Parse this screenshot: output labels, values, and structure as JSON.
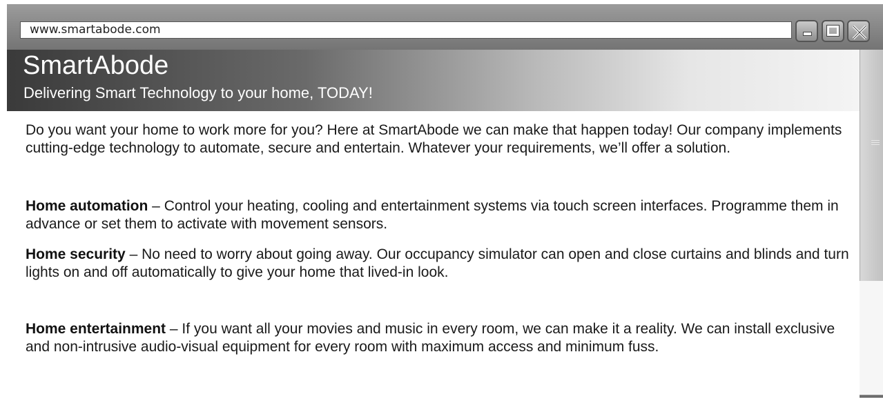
{
  "browser": {
    "url": "www.smartabode.com"
  },
  "site": {
    "title": "SmartAbode",
    "tagline": "Delivering Smart Technology to your home, TODAY!"
  },
  "content": {
    "intro": "Do you want your home to work more for you? Here at SmartAbode we can make that happen today! Our company implements cutting-edge technology to automate, secure and entertain. Whatever your requirements, we’ll offer a solution.",
    "sections": [
      {
        "heading": "Home automation",
        "text": " – Control your heating, cooling and entertainment systems via touch screen interfaces. Programme them in advance or set them to activate with movement sensors."
      },
      {
        "heading": "Home security",
        "text": " – No need to worry about going away. Our occupancy simulator can open and close curtains and blinds and turn lights on and off automatically to give your home that lived-in look."
      },
      {
        "heading": "Home entertainment",
        "text": " – If you want all your movies and music in every room, we can make it a reality. We can install exclusive and non-intrusive audio-visual equipment for every room with maximum access and minimum fuss."
      }
    ]
  },
  "icons": {
    "minimize": "minimize-icon",
    "maximize": "maximize-icon",
    "close": "close-icon"
  }
}
